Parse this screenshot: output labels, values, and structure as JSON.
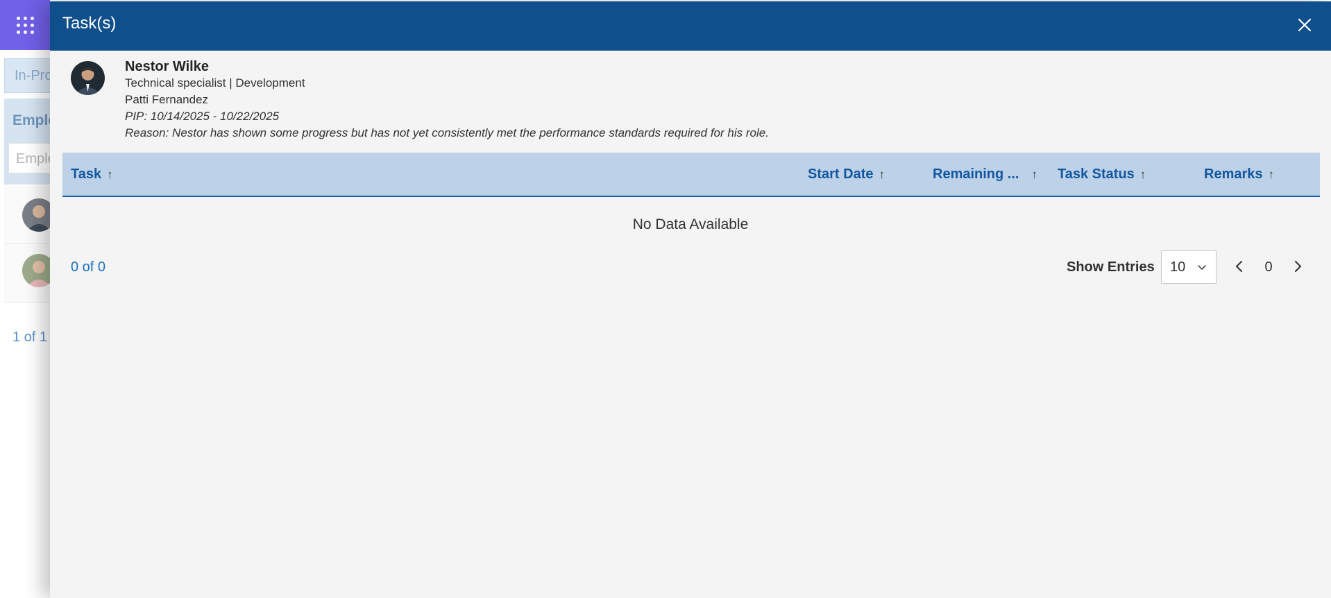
{
  "background": {
    "tab_label": "In-Pro",
    "section_title": "Emplo",
    "search_placeholder": "Emple",
    "pager_text": "1 of 1"
  },
  "panel": {
    "title": "Task(s)",
    "employee": {
      "name": "Nestor Wilke",
      "role": "Technical specialist | Development",
      "manager": "Patti Fernandez",
      "pip": "PIP: 10/14/2025 - 10/22/2025",
      "reason": "Reason: Nestor has shown some progress but has not yet consistently met the performance standards required for his role."
    },
    "table": {
      "columns": [
        {
          "label": "Task",
          "sort": "↑"
        },
        {
          "label": "Start Date",
          "sort": "↑"
        },
        {
          "label": "Remaining ...",
          "sort": "↑"
        },
        {
          "label": "Task Status",
          "sort": "↑"
        },
        {
          "label": "Remarks",
          "sort": "↑"
        }
      ],
      "empty_text": "No Data Available"
    },
    "footer": {
      "count_text": "0 of 0",
      "show_entries_label": "Show Entries",
      "entries_value": "10",
      "page_number": "0"
    }
  },
  "colors": {
    "header_bg": "#0f4f8c",
    "table_header_bg": "#bdd2e8",
    "accent_text": "#1257a0",
    "waffle_bg": "#7160e8"
  },
  "icons": {
    "waffle": "app-launcher-icon",
    "close": "close-icon",
    "prev": "chevron-left-icon",
    "next": "chevron-right-icon",
    "select": "chevron-down-icon"
  }
}
